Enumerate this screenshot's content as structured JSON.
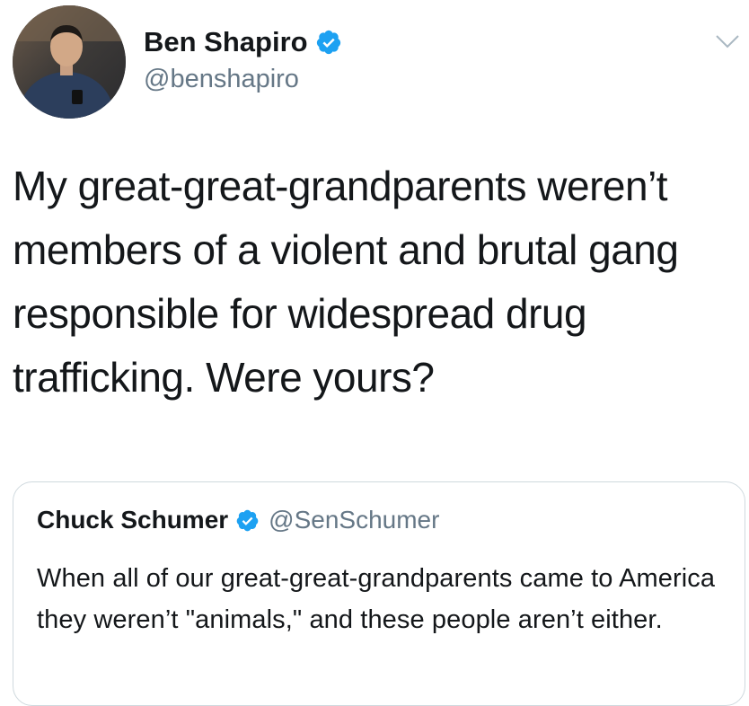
{
  "tweet": {
    "author": {
      "display_name": "Ben Shapiro",
      "handle": "@benshapiro",
      "verified": true
    },
    "text": "My great-great-grandparents weren’t members of a violent and brutal gang responsible for widespread drug trafficking. Were yours?",
    "menu_icon": "chevron-down-icon"
  },
  "quoted_tweet": {
    "author": {
      "display_name": "Chuck Schumer",
      "handle": "@SenSchumer",
      "verified": true
    },
    "text": "When all of our great-great-grandparents came to America they weren’t \"animals,\" and these people aren’t either."
  },
  "colors": {
    "verified_blue": "#1da1f2",
    "handle_gray": "#657786",
    "text": "#14171a",
    "border": "#cfd9de"
  }
}
